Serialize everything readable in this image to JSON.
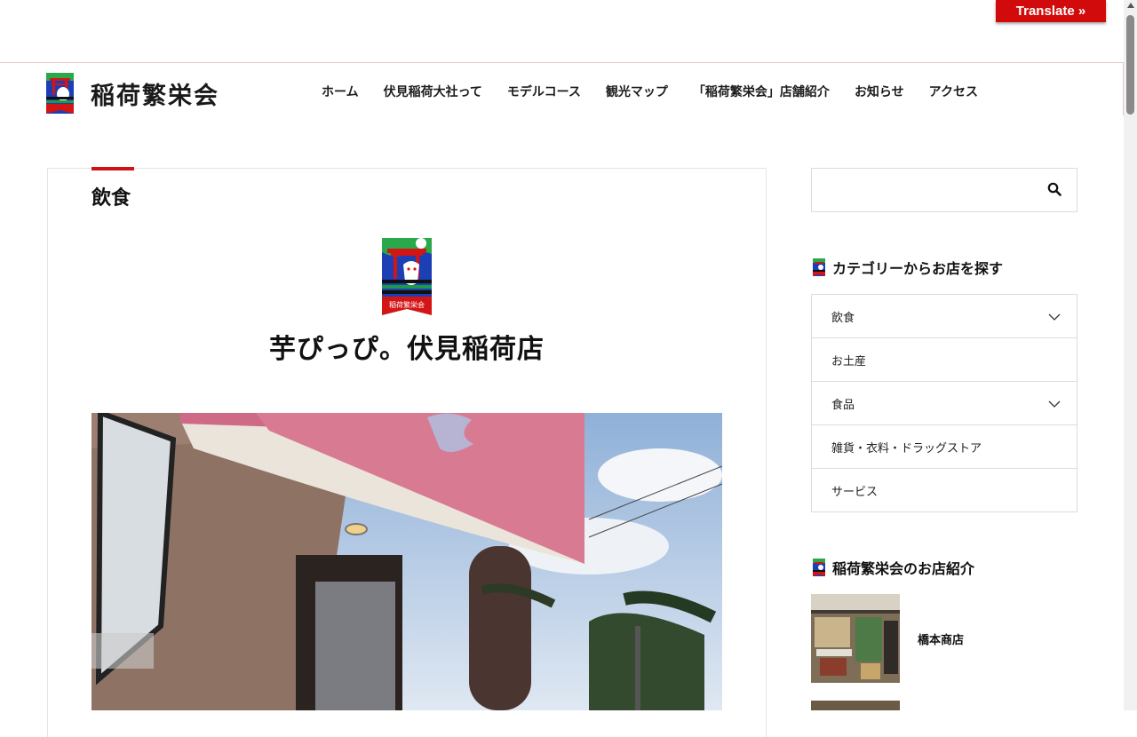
{
  "translate": {
    "label": "Translate »"
  },
  "site": {
    "name": "稲荷繁栄会"
  },
  "nav": {
    "items": [
      {
        "label": "ホーム"
      },
      {
        "label": "伏見稲荷大社って"
      },
      {
        "label": "モデルコース"
      },
      {
        "label": "観光マップ"
      },
      {
        "label": "「稲荷繁栄会」店舗紹介"
      },
      {
        "label": "お知らせ"
      },
      {
        "label": "アクセス"
      }
    ]
  },
  "post": {
    "category": "飲食",
    "title": "芋ぴっぴ。伏見稲荷店",
    "logo_caption": "稲荷繁栄会"
  },
  "sidebar": {
    "search": {
      "placeholder": ""
    },
    "categories_title": "カテゴリーからお店を探す",
    "categories": [
      {
        "label": "飲食",
        "has_children": true
      },
      {
        "label": "お土産",
        "has_children": false
      },
      {
        "label": "食品",
        "has_children": true
      },
      {
        "label": "雑貨・衣料・ドラッグストア",
        "has_children": false
      },
      {
        "label": "サービス",
        "has_children": false
      }
    ],
    "shops_title": "稲荷繁栄会のお店紹介",
    "shops": [
      {
        "name": "橋本商店"
      }
    ]
  },
  "colors": {
    "accent_red": "#d31111",
    "translate_red": "#d10b0b",
    "storefront_pink": "#d97a93"
  }
}
